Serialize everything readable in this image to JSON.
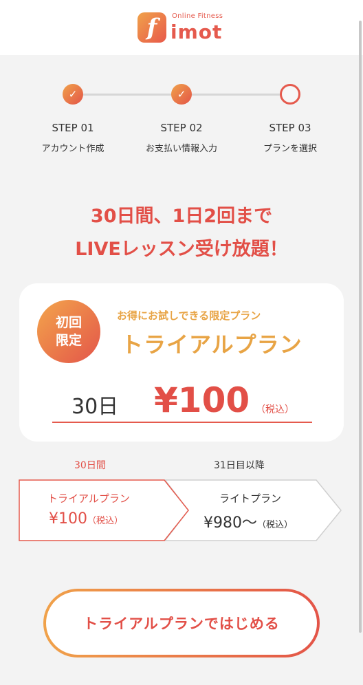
{
  "header": {
    "logo_mark": "f",
    "logo_sub": "Online Fitness",
    "logo_word": "imot"
  },
  "steps": [
    {
      "title": "STEP 01",
      "subtitle": "アカウント作成",
      "status": "done"
    },
    {
      "title": "STEP 02",
      "subtitle": "お支払い情報入力",
      "status": "done"
    },
    {
      "title": "STEP 03",
      "subtitle": "プランを選択",
      "status": "current"
    }
  ],
  "headline": {
    "line1": "30日間、1日2回まで",
    "line2": "LIVEレッスン受け放題！"
  },
  "card": {
    "badge_line1": "初回",
    "badge_line2": "限定",
    "kicker": "お得にお試しできる限定プラン",
    "plan_name": "トライアルプラン",
    "duration": "30日",
    "price": "¥100",
    "tax": "（税込）"
  },
  "timeline": {
    "left_label": "30日間",
    "right_label": "31日目以降",
    "left_plan": "トライアルプラン",
    "left_price": "¥100",
    "left_tax": "（税込）",
    "right_plan": "ライトプラン",
    "right_price": "¥980～",
    "right_tax": "（税込）"
  },
  "cta": {
    "label": "トライアルプランではじめる"
  },
  "colors": {
    "accent": "#e24f47",
    "accent_orange": "#e8a445",
    "gradient_start": "#f0a24a",
    "gradient_end": "#e35448"
  }
}
